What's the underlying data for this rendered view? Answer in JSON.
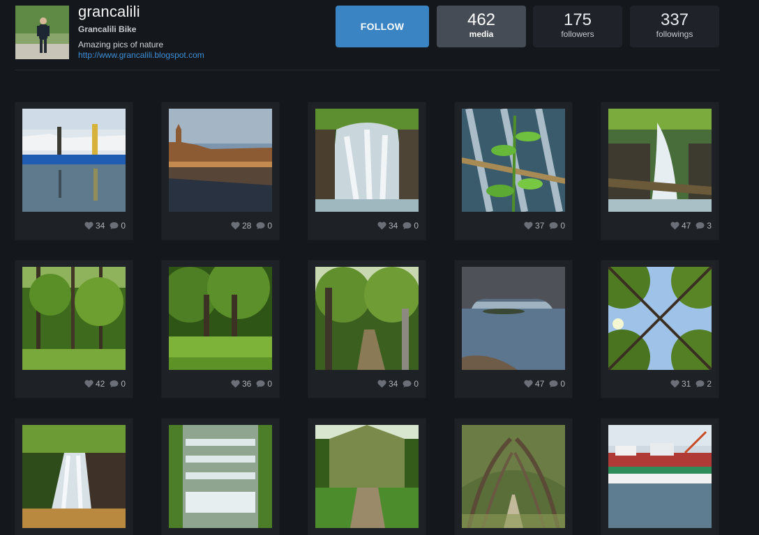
{
  "profile": {
    "username": "grancalili",
    "full_name": "Grancalili Bike",
    "bio": "Amazing pics of nature",
    "website": "http://www.grancalili.blogspot.com"
  },
  "actions": {
    "follow_label": "FOLLOW"
  },
  "stats": [
    {
      "value": "462",
      "label": "media",
      "active": true
    },
    {
      "value": "175",
      "label": "followers",
      "active": false
    },
    {
      "value": "337",
      "label": "followings",
      "active": false
    }
  ],
  "media": [
    {
      "scene": "marina",
      "likes": "34",
      "comments": "0"
    },
    {
      "scene": "cathedral-river",
      "likes": "28",
      "comments": "0"
    },
    {
      "scene": "waterfall",
      "likes": "34",
      "comments": "0"
    },
    {
      "scene": "waterfall-plant",
      "likes": "37",
      "comments": "0"
    },
    {
      "scene": "waterfall-log",
      "likes": "47",
      "comments": "3"
    },
    {
      "scene": "forest",
      "likes": "42",
      "comments": "0"
    },
    {
      "scene": "forest-clearing",
      "likes": "36",
      "comments": "0"
    },
    {
      "scene": "forest-path",
      "likes": "34",
      "comments": "0"
    },
    {
      "scene": "stone-arch-sea",
      "likes": "47",
      "comments": "0"
    },
    {
      "scene": "tree-canopy",
      "likes": "31",
      "comments": "2"
    },
    {
      "scene": "rock-waterfall",
      "likes": "",
      "comments": ""
    },
    {
      "scene": "cascade-steps",
      "likes": "",
      "comments": ""
    },
    {
      "scene": "garden-path",
      "likes": "",
      "comments": ""
    },
    {
      "scene": "tree-tunnel",
      "likes": "",
      "comments": ""
    },
    {
      "scene": "fishing-boats",
      "likes": "",
      "comments": ""
    }
  ],
  "colors": {
    "background": "#14171c",
    "card": "#1e2227",
    "follow_button": "#3a84c3",
    "stat_active": "#454c55",
    "stat": "#1f2329",
    "link": "#3f8fd6"
  }
}
